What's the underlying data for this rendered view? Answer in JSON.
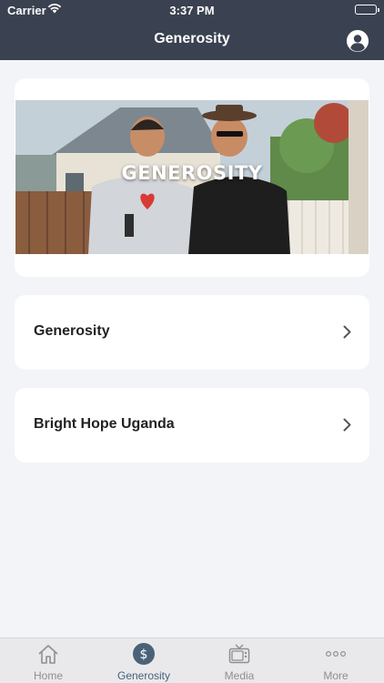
{
  "status_bar": {
    "carrier": "Carrier",
    "time": "3:37 PM"
  },
  "nav": {
    "title": "Generosity",
    "profile_icon": "person-circle-icon"
  },
  "hero": {
    "overlay_text": "GENEROSITY"
  },
  "list": [
    {
      "label": "Generosity"
    },
    {
      "label": "Bright Hope Uganda"
    }
  ],
  "tabs": [
    {
      "label": "Home",
      "icon": "house-icon",
      "active": false
    },
    {
      "label": "Generosity",
      "icon": "dollar-circle-icon",
      "active": true
    },
    {
      "label": "Media",
      "icon": "tv-icon",
      "active": false
    },
    {
      "label": "More",
      "icon": "ellipsis-icon",
      "active": false
    }
  ],
  "colors": {
    "header_bg": "#3a4150",
    "active_tab": "#4a6277",
    "inactive_tab": "#8e8e93",
    "background": "#f3f4f8"
  }
}
